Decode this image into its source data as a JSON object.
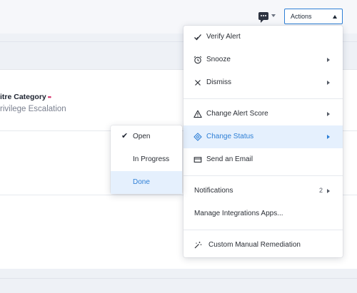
{
  "toolbar": {
    "chat_icon": "chat-bubble-icon",
    "actions_label": "Actions"
  },
  "detail": {
    "mitre_label": "itre Category",
    "mitre_required": "••",
    "mitre_value": "rivilege Escalation"
  },
  "menu": {
    "items": [
      {
        "label": "Verify Alert",
        "icon": "check-icon"
      },
      {
        "label": "Snooze",
        "icon": "alarm-clock-icon"
      },
      {
        "label": "Dismiss",
        "icon": "x-icon"
      },
      {
        "label": "Change Alert Score",
        "icon": "warning-icon"
      },
      {
        "label": "Change Status",
        "icon": "diamond-icon"
      },
      {
        "label": "Send an Email",
        "icon": "envelope-icon"
      },
      {
        "label": "Notifications",
        "count": "2"
      },
      {
        "label": "Manage Integrations Apps..."
      },
      {
        "label": "Custom Manual Remediation",
        "icon": "magic-wand-icon"
      }
    ]
  },
  "status_submenu": {
    "options": [
      {
        "label": "Open",
        "selected": true
      },
      {
        "label": "In Progress"
      },
      {
        "label": "Done"
      }
    ]
  },
  "colors": {
    "accent": "#2e7fd6",
    "highlight": "#e5f0fd",
    "required_marker": "#d6336c"
  }
}
